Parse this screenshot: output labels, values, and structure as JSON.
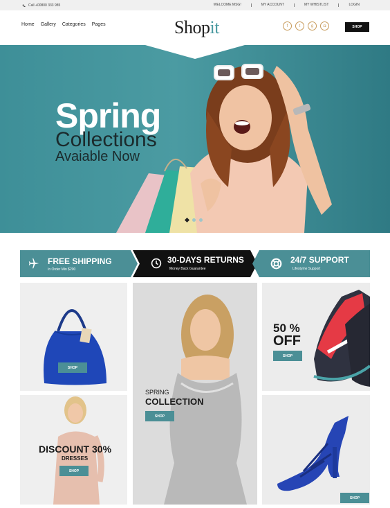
{
  "topbar": {
    "phone": "Call +00800 333 985",
    "links": [
      "WELCOME MSG!",
      "MY ACCOUNT",
      "MY WHISTLIST",
      "LOGIN"
    ]
  },
  "header": {
    "nav": [
      "Home",
      "Gallery",
      "Categories",
      "Pages"
    ],
    "logo_main": "Shop",
    "logo_accent": "it",
    "socials": [
      "facebook-icon",
      "twitter-icon",
      "google-plus-icon",
      "instagram-icon"
    ],
    "shop_button": "SHOP"
  },
  "hero": {
    "title": "Spring",
    "subtitle": "Collections",
    "tagline": "Avaiable Now",
    "slides": 3,
    "active_slide": 1
  },
  "features": [
    {
      "icon": "airplane-icon",
      "title": "FREE SHIPPING",
      "sub": "In Order Min $200"
    },
    {
      "icon": "clock-icon",
      "title": "30-DAYS RETURNS",
      "sub": "Money Back  Guarantee"
    },
    {
      "icon": "lifebuoy-icon",
      "title": "24/7 SUPPORT",
      "sub": "Lifestyme Support"
    }
  ],
  "tiles": {
    "bag": {
      "button": "SHOP"
    },
    "dress": {
      "title": "DISCOUNT 30%",
      "sub": "DRESSES",
      "button": "SHOP"
    },
    "spring": {
      "line1": "SPRING",
      "line2": "COLLECTION",
      "button": "SHOP"
    },
    "shoe": {
      "line1": "50 %",
      "line2": "OFF",
      "button": "SHOP"
    },
    "heel": {
      "button": "SHOP"
    }
  },
  "colors": {
    "accent": "#4b8f96",
    "dark": "#111111",
    "logo_accent": "#4a9aa0",
    "social_ring": "#c79a5a"
  }
}
